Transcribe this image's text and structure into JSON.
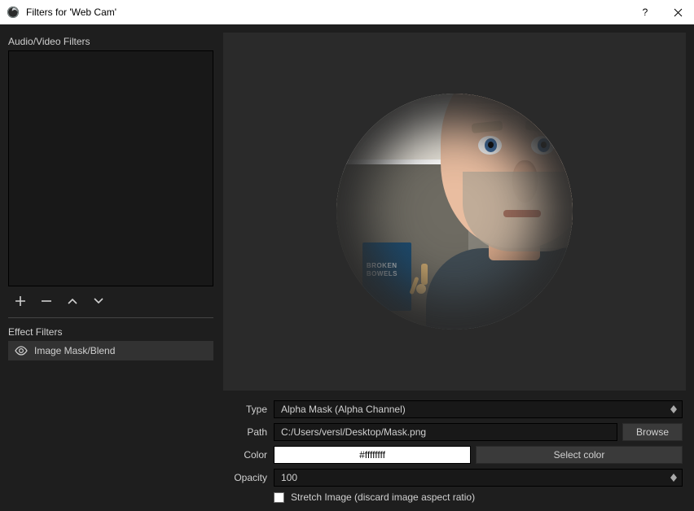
{
  "window": {
    "title": "Filters for 'Web Cam'"
  },
  "left": {
    "audio_video_label": "Audio/Video Filters",
    "effect_label": "Effect Filters",
    "effect_items": [
      {
        "name": "Image Mask/Blend",
        "visible": true
      }
    ]
  },
  "form": {
    "type_label": "Type",
    "type_value": "Alpha Mask (Alpha Channel)",
    "path_label": "Path",
    "path_value": "C:/Users/versl/Desktop/Mask.png",
    "browse_label": "Browse",
    "color_label": "Color",
    "color_value": "#ffffffff",
    "select_color_label": "Select color",
    "opacity_label": "Opacity",
    "opacity_value": "100",
    "stretch_label": "Stretch Image (discard image aspect ratio)",
    "stretch_checked": false
  },
  "preview": {
    "book_text": "BROKEN\nBOWELS"
  }
}
